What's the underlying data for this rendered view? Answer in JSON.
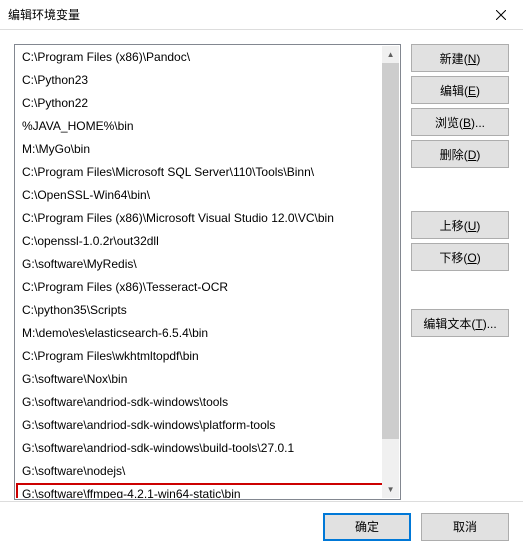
{
  "titlebar": {
    "title": "编辑环境变量"
  },
  "list": {
    "items": [
      "C:\\Program Files (x86)\\Pandoc\\",
      "C:\\Python23",
      "C:\\Python22",
      "%JAVA_HOME%\\bin",
      "M:\\MyGo\\bin",
      "C:\\Program Files\\Microsoft SQL Server\\110\\Tools\\Binn\\",
      "C:\\OpenSSL-Win64\\bin\\",
      "C:\\Program Files (x86)\\Microsoft Visual Studio 12.0\\VC\\bin",
      "C:\\openssl-1.0.2r\\out32dll",
      "G:\\software\\MyRedis\\",
      "C:\\Program Files (x86)\\Tesseract-OCR",
      "C:\\python35\\Scripts",
      "M:\\demo\\es\\elasticsearch-6.5.4\\bin",
      "C:\\Program Files\\wkhtmltopdf\\bin",
      "G:\\software\\Nox\\bin",
      "G:\\software\\andriod-sdk-windows\\tools",
      "G:\\software\\andriod-sdk-windows\\platform-tools",
      "G:\\software\\andriod-sdk-windows\\build-tools\\27.0.1",
      "G:\\software\\nodejs\\",
      "G:\\software\\ffmpeg-4.2.1-win64-static\\bin"
    ],
    "highlighted_index": 19
  },
  "buttons": {
    "new": {
      "label": "新建",
      "accel": "N"
    },
    "edit": {
      "label": "编辑",
      "accel": "E"
    },
    "browse": {
      "label": "浏览",
      "accel": "B",
      "suffix": "..."
    },
    "delete": {
      "label": "删除",
      "accel": "D"
    },
    "move_up": {
      "label": "上移",
      "accel": "U"
    },
    "move_down": {
      "label": "下移",
      "accel": "O"
    },
    "edit_text": {
      "label": "编辑文本",
      "accel": "T",
      "suffix": "..."
    }
  },
  "footer": {
    "ok": "确定",
    "cancel": "取消"
  }
}
